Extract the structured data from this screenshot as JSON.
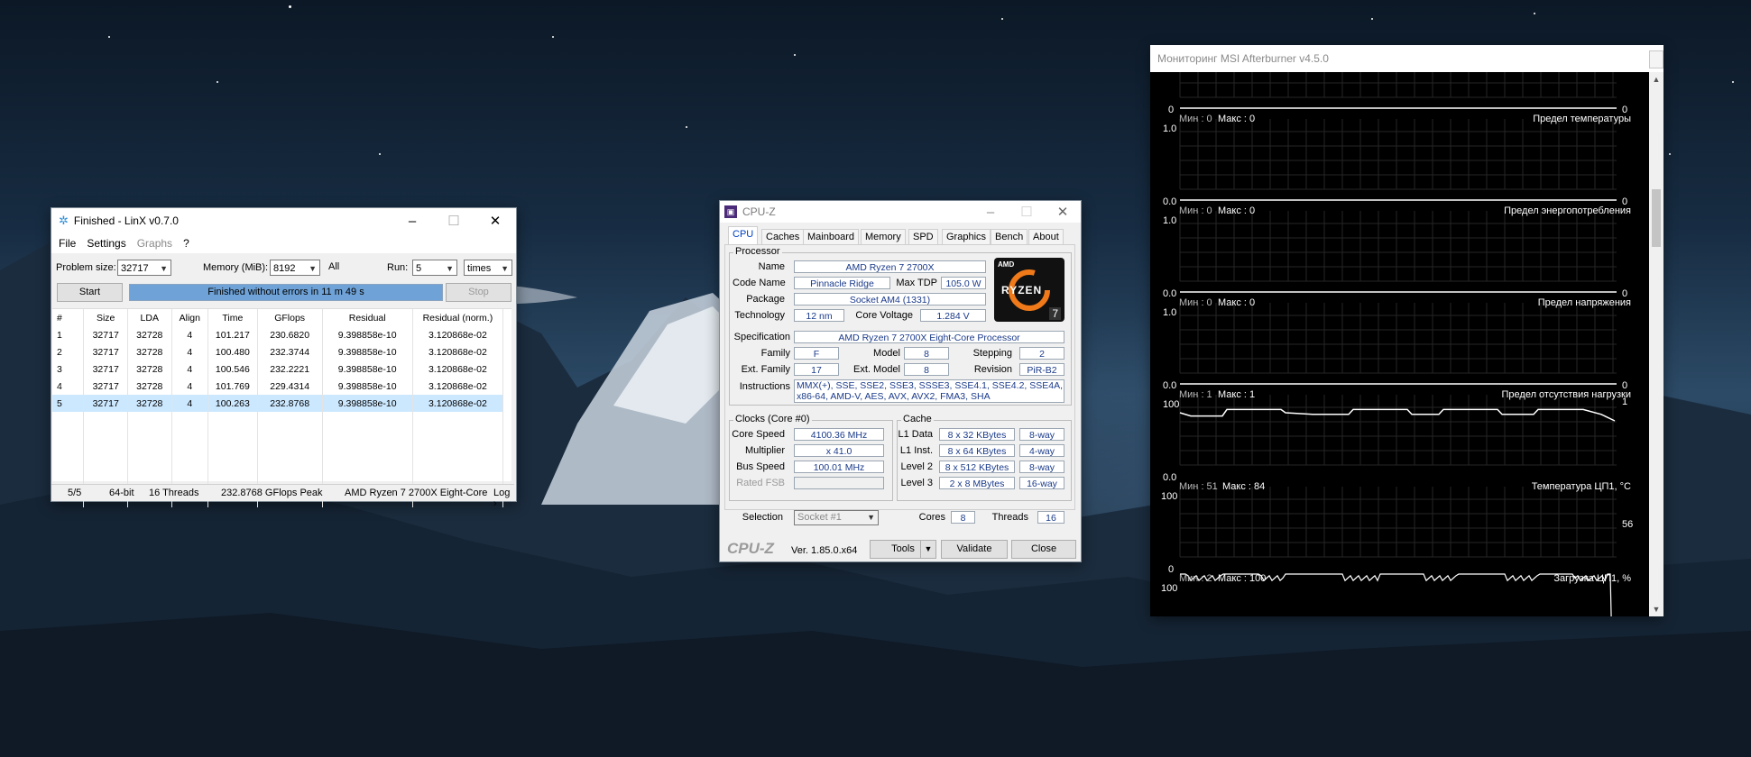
{
  "linx": {
    "title": "Finished - LinX v0.7.0",
    "menu": [
      "File",
      "Settings",
      "Graphs",
      "?"
    ],
    "problem_size_label": "Problem size:",
    "problem_size_value": "32717",
    "memory_label": "Memory (MiB):",
    "memory_value": "8192",
    "all_label": "All",
    "run_label": "Run:",
    "run_value": "5",
    "run_unit": "times",
    "start_label": "Start",
    "stop_label": "Stop",
    "progress_text": "Finished without errors in 11 m 49 s",
    "progress_fraction": 1.0,
    "columns": [
      "#",
      "Size",
      "LDA",
      "Align",
      "Time",
      "GFlops",
      "Residual",
      "Residual (norm.)"
    ],
    "rows": [
      [
        "1",
        "32717",
        "32728",
        "4",
        "101.217",
        "230.6820",
        "9.398858e-10",
        "3.120868e-02"
      ],
      [
        "2",
        "32717",
        "32728",
        "4",
        "100.480",
        "232.3744",
        "9.398858e-10",
        "3.120868e-02"
      ],
      [
        "3",
        "32717",
        "32728",
        "4",
        "100.546",
        "232.2221",
        "9.398858e-10",
        "3.120868e-02"
      ],
      [
        "4",
        "32717",
        "32728",
        "4",
        "101.769",
        "229.4314",
        "9.398858e-10",
        "3.120868e-02"
      ],
      [
        "5",
        "32717",
        "32728",
        "4",
        "100.263",
        "232.8768",
        "9.398858e-10",
        "3.120868e-02"
      ]
    ],
    "status": {
      "progress": "5/5",
      "bits": "64-bit",
      "threads": "16 Threads",
      "peak": "232.8768 GFlops Peak",
      "cpu": "AMD Ryzen 7 2700X Eight-Core",
      "log": "Log ›"
    }
  },
  "cpuz": {
    "title": "CPU-Z",
    "tabs": [
      "CPU",
      "Caches",
      "Mainboard",
      "Memory",
      "SPD",
      "Graphics",
      "Bench",
      "About"
    ],
    "processor": {
      "group": "Processor",
      "name_label": "Name",
      "name": "AMD Ryzen 7 2700X",
      "code_label": "Code Name",
      "code": "Pinnacle Ridge",
      "tdp_label": "Max TDP",
      "tdp": "105.0 W",
      "package_label": "Package",
      "package": "Socket AM4 (1331)",
      "tech_label": "Technology",
      "tech": "12 nm",
      "voltage_label": "Core Voltage",
      "voltage": "1.284 V",
      "spec_label": "Specification",
      "spec": "AMD Ryzen 7 2700X Eight-Core Processor",
      "family_label": "Family",
      "family": "F",
      "model_label": "Model",
      "model": "8",
      "stepping_label": "Stepping",
      "stepping": "2",
      "extfamily_label": "Ext. Family",
      "extfamily": "17",
      "extmodel_label": "Ext. Model",
      "extmodel": "8",
      "revision_label": "Revision",
      "revision": "PiR-B2",
      "instr_label": "Instructions",
      "instr_line1": "MMX(+), SSE, SSE2, SSE3, SSSE3, SSE4.1, SSE4.2, SSE4A,",
      "instr_line2": "x86-64, AMD-V, AES, AVX, AVX2, FMA3, SHA"
    },
    "logo": {
      "brand": "AMD",
      "line": "RYZEN",
      "tier": "7"
    },
    "clocks": {
      "group": "Clocks (Core #0)",
      "speed_label": "Core Speed",
      "speed": "4100.36 MHz",
      "mult_label": "Multiplier",
      "mult": "x 41.0",
      "bus_label": "Bus Speed",
      "bus": "100.01 MHz",
      "fsb_label": "Rated FSB",
      "fsb": ""
    },
    "cache": {
      "group": "Cache",
      "l1d_label": "L1 Data",
      "l1d": "8 x 32 KBytes",
      "l1d_way": "8-way",
      "l1i_label": "L1 Inst.",
      "l1i": "8 x 64 KBytes",
      "l1i_way": "4-way",
      "l2_label": "Level 2",
      "l2": "8 x 512 KBytes",
      "l2_way": "8-way",
      "l3_label": "Level 3",
      "l3": "2 x 8 MBytes",
      "l3_way": "16-way"
    },
    "selection_label": "Selection",
    "selection": "Socket #1",
    "cores_label": "Cores",
    "cores": "8",
    "threads_label": "Threads",
    "threads": "16",
    "brand": "CPU-Z",
    "version": "Ver. 1.85.0.x64",
    "tools_label": "Tools",
    "validate_label": "Validate",
    "close_label": "Close"
  },
  "afterburner": {
    "title": "Мониторинг MSI Afterburner v4.5.0",
    "graphs": [
      {
        "name": "Предел температуры",
        "min": "Мин : 0",
        "max": "Макс : 0",
        "top": "",
        "bottom": "0",
        "right_top": "",
        "right_bottom": "0",
        "right_val": ""
      },
      {
        "name": "Предел энергопотребления",
        "min": "Мин : 0",
        "max": "Макс : 0",
        "top": "1.0",
        "bottom": "0.0",
        "right_top": "",
        "right_bottom": "0",
        "right_val": ""
      },
      {
        "name": "Предел напряжения",
        "min": "Мин : 0",
        "max": "Макс : 0",
        "top": "1.0",
        "bottom": "0.0",
        "right_top": "",
        "right_bottom": "0",
        "right_val": ""
      },
      {
        "name": "Предел отсутствия нагрузки",
        "min": "Мин : 1",
        "max": "Макс : 1",
        "top": "1.0",
        "bottom": "0.0",
        "right_top": "1",
        "right_bottom": "0",
        "right_val": ""
      },
      {
        "name": "Температура ЦП1, °С",
        "min": "Мин : 51",
        "max": "Макс : 84",
        "top": "100",
        "bottom": "0.0",
        "right_top": "",
        "right_bottom": "",
        "right_val": "56"
      },
      {
        "name": "Загрузка ЦП1, %",
        "min": "Мин : 2",
        "max": "Макс : 100",
        "top": "100",
        "bottom": "0",
        "right_top": "",
        "right_bottom": "",
        "right_val": ""
      }
    ]
  }
}
